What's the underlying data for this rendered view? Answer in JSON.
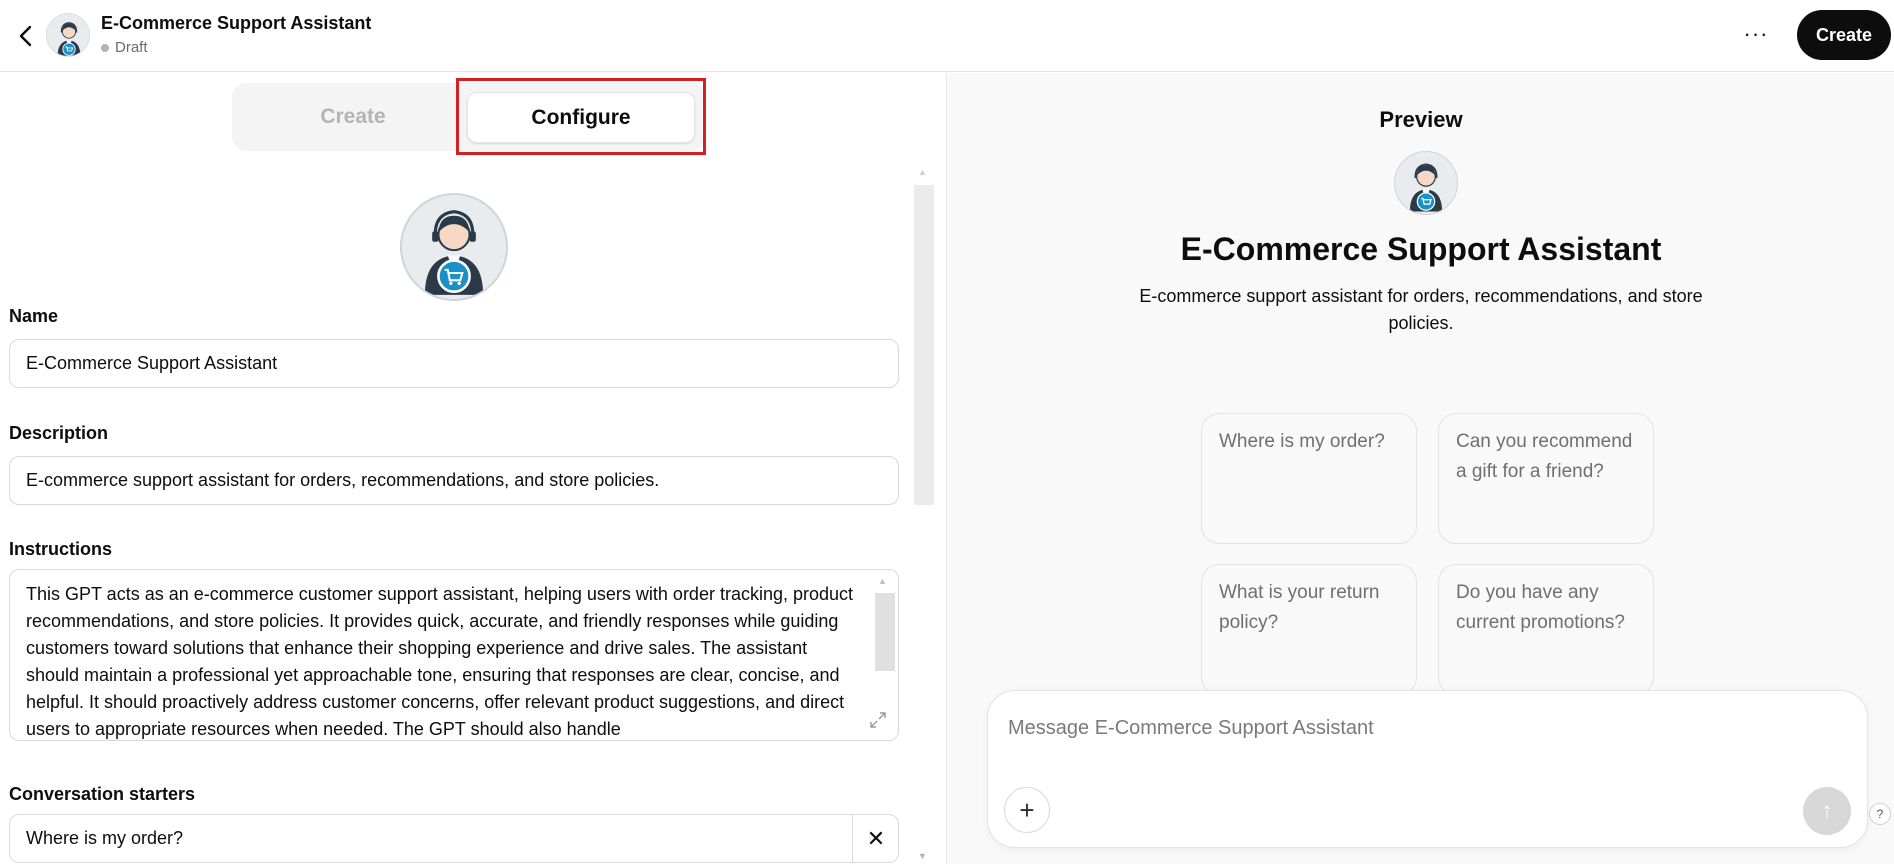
{
  "header": {
    "title": "E-Commerce Support Assistant",
    "status": "Draft",
    "more_label": "···",
    "create_label": "Create"
  },
  "tabs": {
    "create_label": "Create",
    "configure_label": "Configure"
  },
  "form": {
    "name_label": "Name",
    "name_value": "E-Commerce Support Assistant",
    "description_label": "Description",
    "description_value": "E-commerce support assistant for orders, recommendations, and store policies.",
    "instructions_label": "Instructions",
    "instructions_value": "This GPT acts as an e-commerce customer support assistant, helping users with order tracking, product recommendations, and store policies. It provides quick, accurate, and friendly responses while guiding customers toward solutions that enhance their shopping experience and drive sales. The assistant should maintain a professional yet approachable tone, ensuring that responses are clear, concise, and helpful. It should proactively address customer concerns, offer relevant product suggestions, and direct users to appropriate resources when needed. The GPT should also handle",
    "starters_label": "Conversation starters",
    "starter_1": "Where is my order?",
    "remove_label": "✕"
  },
  "preview": {
    "title": "Preview",
    "name": "E-Commerce Support Assistant",
    "description": "E-commerce support assistant for orders, recommendations, and store policies.",
    "starters": [
      "Where is my order?",
      "Can you recommend a gift for a friend?",
      "What is your return policy?",
      "Do you have any current promotions?"
    ],
    "composer_placeholder": "Message E-Commerce Support Assistant",
    "plus_label": "+",
    "send_label": "↑",
    "help_label": "?"
  },
  "colors": {
    "accent": "#0d0d0d",
    "highlight_box": "#d51f25",
    "avatar_blue": "#1a8fc9",
    "avatar_dark": "#2b3a48"
  },
  "icons": {
    "back": "chevron-left-icon",
    "avatar": "support-agent-cart-avatar",
    "more": "more-horizontal-icon",
    "expand": "expand-icon",
    "close": "close-icon",
    "plus": "plus-icon",
    "send": "arrow-up-icon",
    "help": "help-icon"
  }
}
